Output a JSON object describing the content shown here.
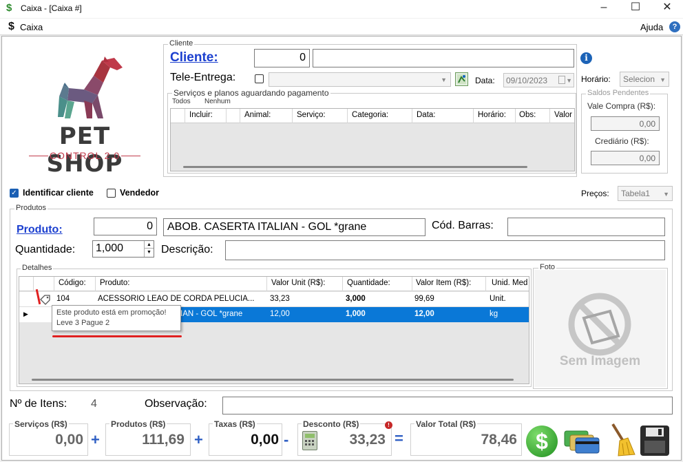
{
  "window": {
    "title": "Caixa - [Caixa #]",
    "app_icon": "dollar-icon"
  },
  "menu": {
    "caixa": "Caixa",
    "ajuda": "Ajuda"
  },
  "logo": {
    "line1": "PET SHOP",
    "line2": "CONTROL 2.0"
  },
  "cliente_group": {
    "legend": "Cliente",
    "cliente_link": "Cliente:",
    "cliente_code": "0",
    "cliente_name": "",
    "tele_entrega_label": "Tele-Entrega:",
    "data_label": "Data:",
    "data_value": "09/10/2023",
    "horario_label": "Horário:",
    "horario_value": "Selecion",
    "servicos_legend": "Serviços e planos aguardando pagamento",
    "filter_todos": "Todos",
    "filter_nenhum": "Nenhum",
    "columns": [
      "Incluir:",
      "Animal:",
      "Serviço:",
      "Categoria:",
      "Data:",
      "Horário:",
      "Obs:",
      "Valor"
    ]
  },
  "saldos": {
    "legend": "Saldos Pendentes",
    "vale_compra_label": "Vale Compra (R$):",
    "vale_compra_value": "0,00",
    "crediario_label": "Crediário (R$):",
    "crediario_value": "0,00"
  },
  "options": {
    "identificar_cliente": "Identificar cliente",
    "identificar_checked": true,
    "vendedor": "Vendedor",
    "vendedor_checked": false,
    "precos_label": "Preços:",
    "precos_value": "Tabela1"
  },
  "produtos_group": {
    "legend": "Produtos",
    "produto_link": "Produto:",
    "produto_code": "0",
    "produto_name": "ABOB. CASERTA ITALIAN - GOL *grane",
    "cod_barras_label": "Cód. Barras:",
    "cod_barras_value": "",
    "quantidade_label": "Quantidade:",
    "quantidade_value": "1,000",
    "descricao_label": "Descrição:",
    "descricao_value": ""
  },
  "detalhes": {
    "legend": "Detalhes",
    "columns": [
      "Código:",
      "Produto:",
      "Valor Unit (R$):",
      "Quantidade:",
      "Valor Item (R$):",
      "Unid. Med"
    ],
    "rows": [
      {
        "codigo": "104",
        "produto": "ACESSORIO LEAO DE CORDA PELUCIA...",
        "valor_unit": "33,23",
        "quantidade": "3,000",
        "valor_item": "99,69",
        "unid": "Unit."
      },
      {
        "codigo": "",
        "produto": "IAN - GOL *grane",
        "valor_unit": "12,00",
        "quantidade": "1,000",
        "valor_item": "12,00",
        "unid": "kg"
      }
    ],
    "tooltip_line1": "Este produto está em promoção!",
    "tooltip_line2": "Leve 3 Pague 2"
  },
  "foto": {
    "legend": "Foto",
    "placeholder": "Sem Imagem"
  },
  "footer": {
    "num_itens_label": "Nº de Itens:",
    "num_itens_value": "4",
    "observacao_label": "Observação:",
    "observacao_value": ""
  },
  "totals": {
    "servicos_label": "Serviços (R$)",
    "servicos_value": "0,00",
    "produtos_label": "Produtos (R$)",
    "produtos_value": "111,69",
    "taxas_label": "Taxas (R$)",
    "taxas_value": "0,00",
    "desconto_label": "Desconto (R$)",
    "desconto_value": "33,23",
    "total_label": "Valor Total (R$)",
    "total_value": "78,46",
    "op_plus1": "+",
    "op_plus2": "+",
    "op_minus": "-",
    "op_equals": "="
  },
  "colors": {
    "link_blue": "#1b3fcf",
    "selected_row": "#0a78d7",
    "money_green": "#2e8b2e"
  }
}
